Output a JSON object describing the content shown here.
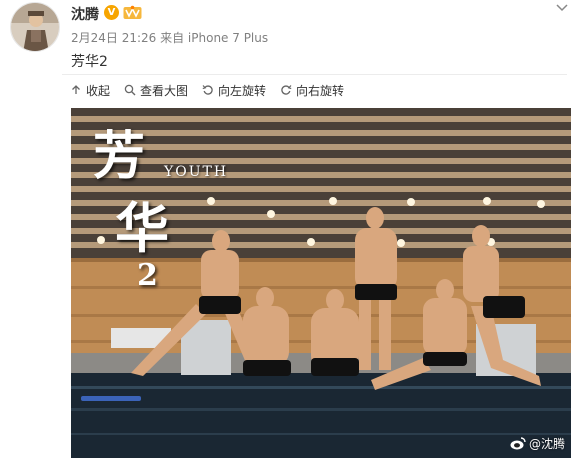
{
  "post": {
    "username": "沈腾",
    "verified_badge": "V",
    "meta": "2月24日 21:26 来自 iPhone 7 Plus",
    "caption": "芳华2"
  },
  "toolbar": {
    "collapse_label": "收起",
    "view_large_label": "查看大图",
    "rotate_left_label": "向左旋转",
    "rotate_right_label": "向右旋转"
  },
  "photo": {
    "title_big_1": "芳",
    "title_big_2": "华",
    "title_big_3": "2",
    "title_small": "YOUTH",
    "watermark": "@沈腾"
  },
  "colors": {
    "verified": "#f7a500",
    "text": "#333333",
    "meta": "#808080"
  },
  "icons": [
    "avatar",
    "verified-icon",
    "vip-icon",
    "chevron-down-icon",
    "collapse-icon",
    "zoom-icon",
    "rotate-left-icon",
    "rotate-right-icon",
    "weibo-icon"
  ]
}
